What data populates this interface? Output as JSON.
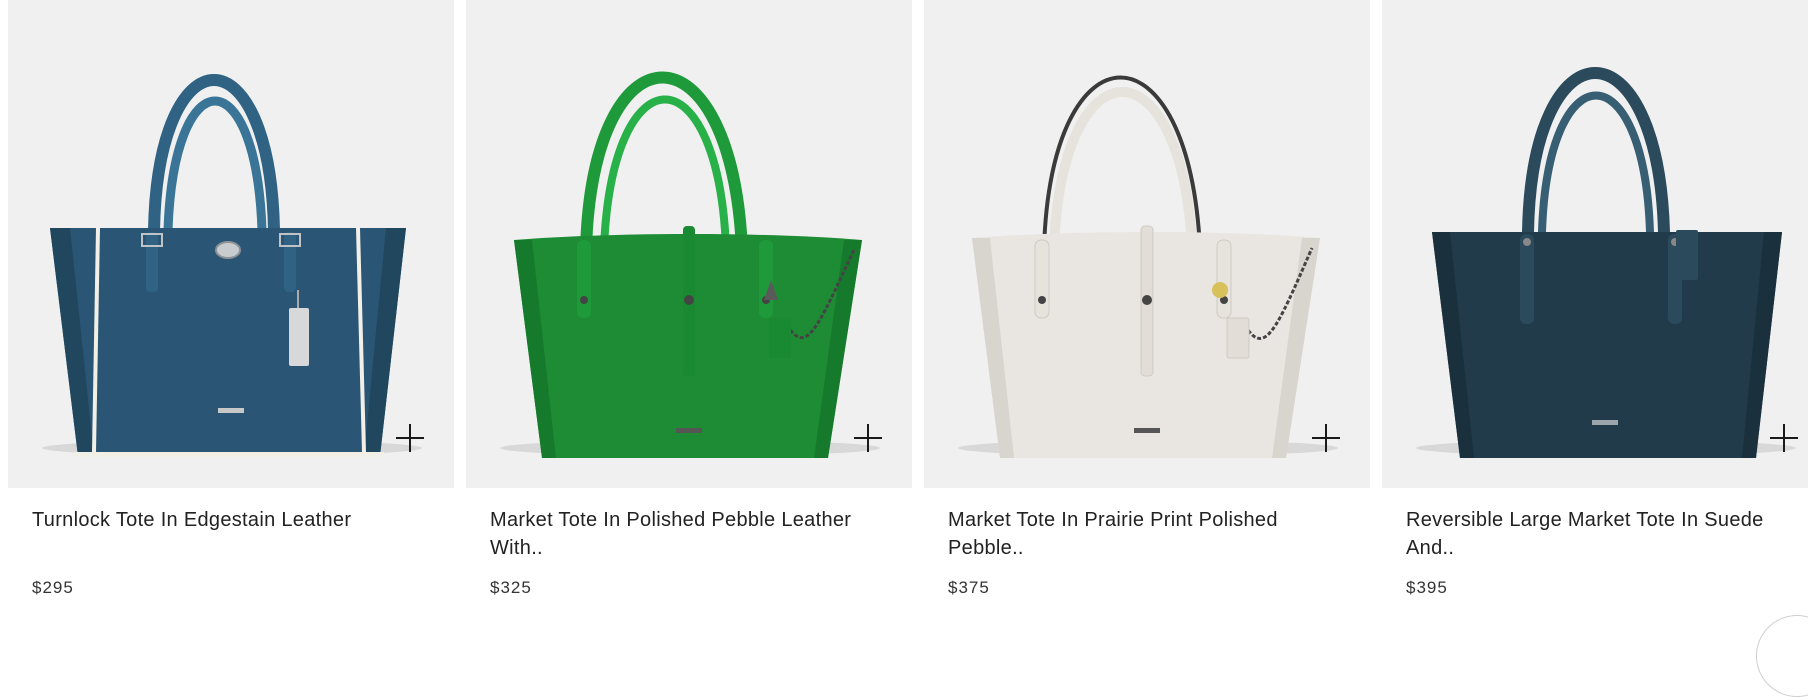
{
  "products": [
    {
      "name": "Turnlock Tote In Edgestain Leather",
      "price": "$295",
      "bag_color": "#2a5575",
      "handle_color": "#2f6283",
      "trim_color": "#f2efe6",
      "image_name": "turnlock-tote-image"
    },
    {
      "name": "Market Tote In Polished Pebble Leather With..",
      "price": "$325",
      "bag_color": "#1d8c35",
      "handle_color": "#1f9a3a",
      "trim_color": "#167a2c",
      "image_name": "market-tote-green-image"
    },
    {
      "name": "Market Tote In Prairie Print Polished Pebble..",
      "price": "$375",
      "bag_color": "#e9e6e1",
      "handle_color": "#e6e2dc",
      "trim_color": "#cfcac3",
      "image_name": "market-tote-chalk-image"
    },
    {
      "name": "Reversible Large Market Tote In Suede And..",
      "price": "$395",
      "bag_color": "#223b4a",
      "handle_color": "#2b4a5c",
      "trim_color": "#1a303d",
      "image_name": "reversible-market-tote-image"
    }
  ],
  "icons": {
    "add": "plus-icon"
  },
  "colors": {
    "image_background": "#f0f0f0",
    "text": "#222222"
  }
}
